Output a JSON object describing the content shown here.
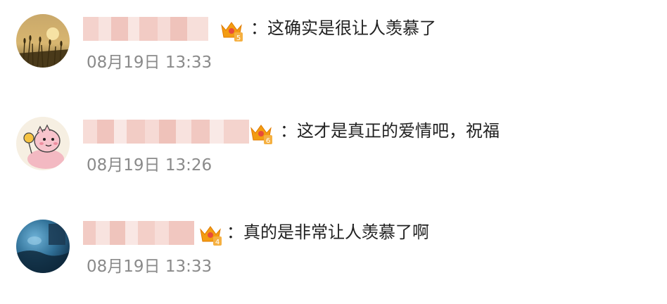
{
  "comments": [
    {
      "separator": "：",
      "text": "这确实是很让人羡慕了",
      "timestamp": "08月19日 13:33",
      "badge_level": "5",
      "badge_icon": "crown-badge-icon"
    },
    {
      "separator": "：",
      "text": "这才是真正的爱情吧，祝福",
      "timestamp": "08月19日 13:26",
      "badge_level": "6",
      "badge_icon": "crown-badge-icon"
    },
    {
      "separator": "：",
      "text": "真的是非常让人羡慕了啊",
      "timestamp": "08月19日 13:33",
      "badge_level": "4",
      "badge_icon": "crown-badge-icon"
    }
  ],
  "colors": {
    "comment_text": "#222222",
    "timestamp": "#8a8a8a",
    "name_blur": "#f2c9c3",
    "badge_orange": "#f39c12"
  }
}
